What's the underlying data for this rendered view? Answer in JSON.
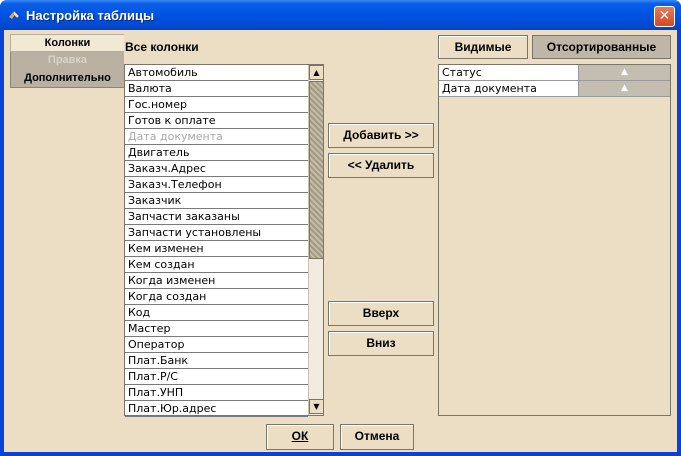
{
  "window": {
    "title": "Настройка таблицы",
    "close_glyph": "✕"
  },
  "tabs": [
    {
      "label": "Колонки"
    },
    {
      "label": "Правка"
    },
    {
      "label": "Дополнительно"
    }
  ],
  "all_columns": {
    "label": "Все колонки",
    "items": [
      {
        "label": "Автомобиль"
      },
      {
        "label": "Валюта"
      },
      {
        "label": "Гос.номер"
      },
      {
        "label": "Готов к оплате"
      },
      {
        "label": "Дата документа"
      },
      {
        "label": "Двигатель"
      },
      {
        "label": "Заказч.Адрес"
      },
      {
        "label": "Заказч.Телефон"
      },
      {
        "label": "Заказчик"
      },
      {
        "label": "Запчасти заказаны"
      },
      {
        "label": "Запчасти установлены"
      },
      {
        "label": "Кем изменен"
      },
      {
        "label": "Кем создан"
      },
      {
        "label": "Когда изменен"
      },
      {
        "label": "Когда создан"
      },
      {
        "label": "Код"
      },
      {
        "label": "Мастер"
      },
      {
        "label": "Оператор"
      },
      {
        "label": "Плат.Банк"
      },
      {
        "label": "Плат.Р/С"
      },
      {
        "label": "Плат.УНП"
      },
      {
        "label": "Плат.Юр.адрес"
      }
    ]
  },
  "actions": {
    "add": "Добавить >>",
    "remove": "<< Удалить",
    "up": "Вверх",
    "down": "Вниз"
  },
  "view_toggle": {
    "visible": "Видимые",
    "sorted": "Отсортированные"
  },
  "sorted_columns": [
    {
      "label": "Статус",
      "sort_glyph": "▲"
    },
    {
      "label": "Дата документа",
      "sort_glyph": "▲"
    }
  ],
  "footer": {
    "ok": "ОК",
    "cancel": "Отмена"
  },
  "icons": {
    "scroll_up": "▲",
    "scroll_down": "▼"
  }
}
